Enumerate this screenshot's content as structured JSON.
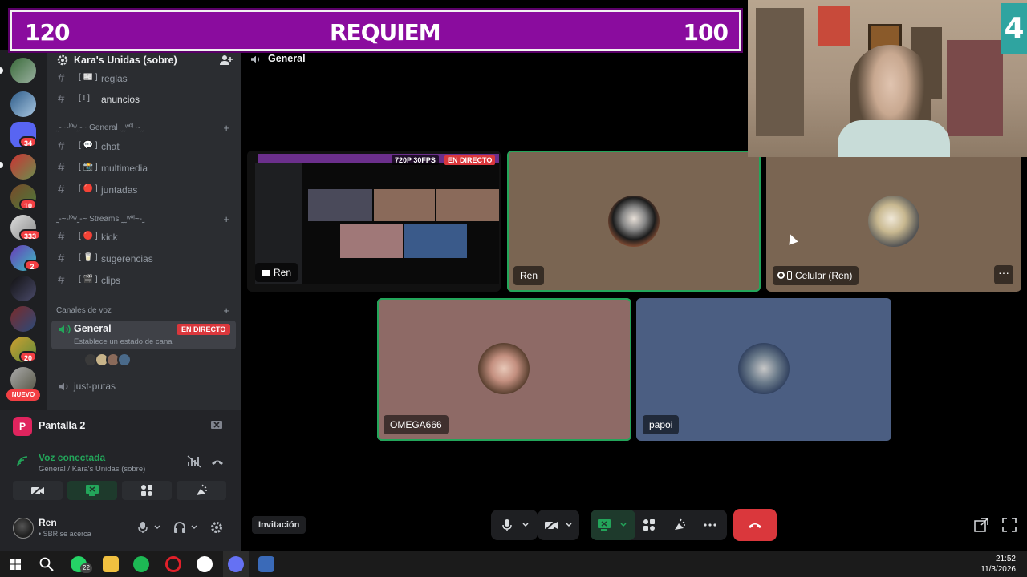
{
  "overlay": {
    "left_score": "120",
    "title": "REQUIEM",
    "right_score": "100",
    "counter": "4"
  },
  "server_rail": {
    "badges": [
      "34",
      "10",
      "333",
      "2",
      "20"
    ],
    "new_label": "NUEVO"
  },
  "sidebar": {
    "server_name": "Kara's Unidas (sobre)",
    "channels_top": [
      {
        "emoji": "[ 📰 ]",
        "label": "reglas"
      },
      {
        "emoji": "[ ! ]",
        "label": "anuncios"
      }
    ],
    "cat_general": "˷-~-ˡºʷ˷-~ General ˷˷ʷºˡ~-˷",
    "channels_general": [
      {
        "emoji": "[ 💬 ]",
        "label": "chat"
      },
      {
        "emoji": "[ 📸 ]",
        "label": "multimedia"
      },
      {
        "emoji": "[ 🔴 ]",
        "label": "juntadas"
      }
    ],
    "cat_streams": "˷-~-ˡºʷ˷-~ Streams ˷˷ʷºˡ~-˷",
    "channels_streams": [
      {
        "emoji": "[ 🔴 ]",
        "label": "kick"
      },
      {
        "emoji": "[ 🥛 ]",
        "label": "sugerencias"
      },
      {
        "emoji": "[ 🎬 ]",
        "label": "clips"
      }
    ],
    "cat_voice": "Canales de voz",
    "voice_general": {
      "label": "General",
      "live": "EN DIRECTO",
      "status": "Establece un estado de canal"
    },
    "voice_other": "just-putas"
  },
  "stream_panel": {
    "title": "Pantalla 2",
    "avatar_letter": "P",
    "voice_connected": "Voz conectada",
    "voice_sub": "General / Kara's Unidas (sobre)"
  },
  "user_panel": {
    "name": "Ren",
    "status": "• SBR se acerca"
  },
  "main": {
    "channel": "General",
    "share_quality": "720P 30FPS",
    "share_live": "EN DIRECTO",
    "share_name": "Ren",
    "tiles": [
      {
        "name": "Ren"
      },
      {
        "name": "Celular (Ren)"
      },
      {
        "name": "OMEGA666"
      },
      {
        "name": "papoi"
      }
    ],
    "invite_label": "Invitación"
  },
  "taskbar": {
    "whatsapp_badge": "22",
    "time": "21:52",
    "date": "11/3/2026"
  },
  "colors": {
    "accent_green": "#23a55a",
    "live_red": "#da373c",
    "banner_purple": "#8a0c9e"
  }
}
